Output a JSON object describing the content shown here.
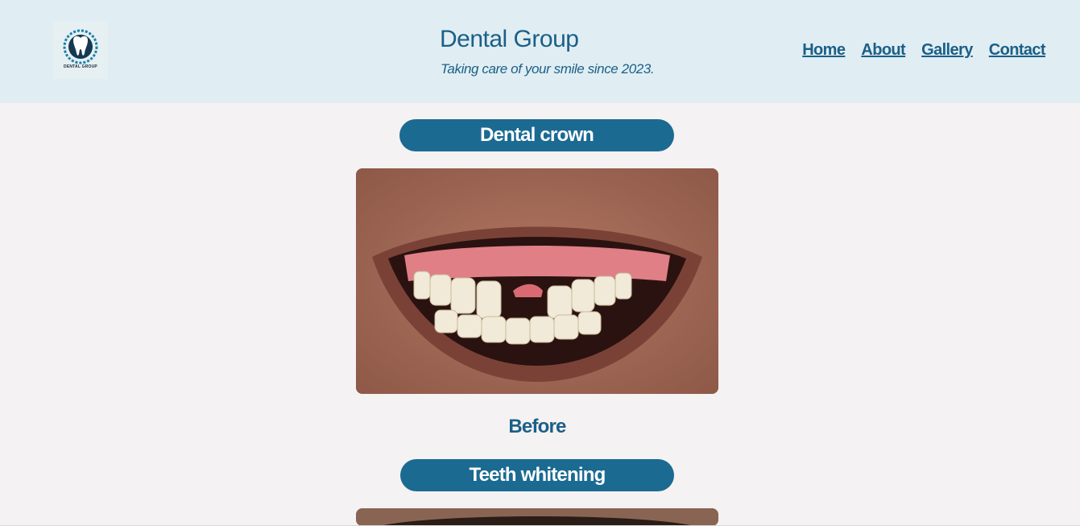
{
  "header": {
    "logo_caption": "DENTAL GROUP",
    "site_title": "Dental Group",
    "tagline": "Taking care of your smile since 2023.",
    "logo_icon": "tooth-icon"
  },
  "nav": {
    "items": [
      {
        "label": "Home"
      },
      {
        "label": "About"
      },
      {
        "label": "Gallery"
      },
      {
        "label": "Contact"
      }
    ]
  },
  "gallery": {
    "sections": [
      {
        "title": "Dental crown",
        "caption": "Before",
        "image": "open-mouth-smile-with-missing-front-tooth"
      },
      {
        "title": "Teeth whitening",
        "image": "beard-and-mouth-photo"
      }
    ]
  },
  "colors": {
    "header_bg": "#e0eef3",
    "page_bg": "#f4f2f2",
    "accent": "#1b6a92",
    "text": "#1b5f87"
  }
}
